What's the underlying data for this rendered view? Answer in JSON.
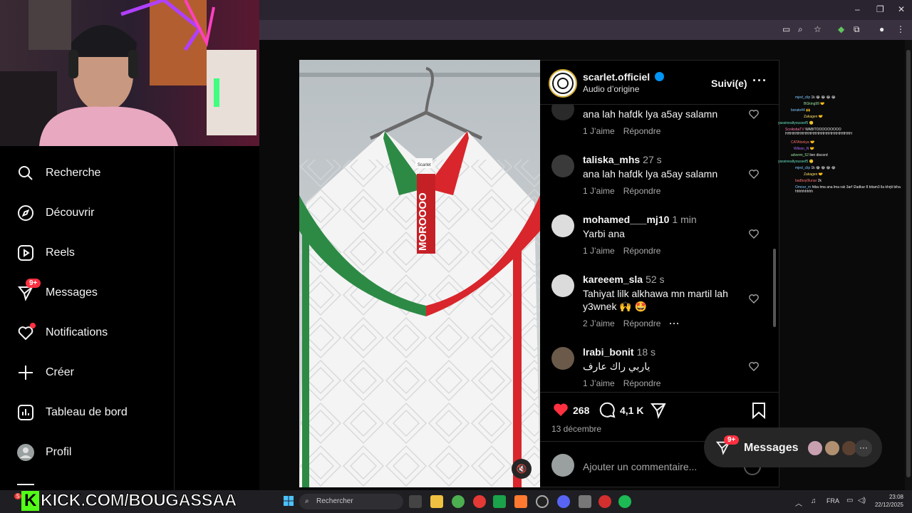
{
  "sidebar": {
    "items": [
      {
        "label": "Recherche",
        "icon": "search-icon"
      },
      {
        "label": "Découvrir",
        "icon": "compass-icon"
      },
      {
        "label": "Reels",
        "icon": "reels-icon"
      },
      {
        "label": "Messages",
        "icon": "messenger-icon",
        "badge": "9+"
      },
      {
        "label": "Notifications",
        "icon": "heart-icon"
      },
      {
        "label": "Créer",
        "icon": "plus-icon"
      },
      {
        "label": "Tableau de bord",
        "icon": "dashboard-icon"
      },
      {
        "label": "Profil",
        "icon": "avatar-icon"
      }
    ]
  },
  "post": {
    "username": "scarlet.officiel",
    "subtitle": "Audio d’origine",
    "follow_label": "Suivi(e)",
    "image_tag": "Scarlet",
    "collar_text": "MOROOOO",
    "likes": "268",
    "comments_count": "4,1 K",
    "date": "13 décembre",
    "add_comment_placeholder": "Ajouter un commentaire..."
  },
  "comments": [
    {
      "user": "",
      "time": "",
      "text": "ana lah hafdk lya a5ay salamn",
      "likes": "1 J’aime",
      "reply": "Répondre"
    },
    {
      "user": "taliska_mhs",
      "time": "27 s",
      "text": "ana lah hafdk lya a5ay salamn",
      "likes": "1 J’aime",
      "reply": "Répondre"
    },
    {
      "user": "mohamed___mj10",
      "time": "1 min",
      "text": "Yarbi ana",
      "likes": "1 J’aime",
      "reply": "Répondre"
    },
    {
      "user": "kareeem_sla",
      "time": "52 s",
      "text": "Tahiyat lilk alkhawa mn martil lah y3wnek 🙌 🤩",
      "likes": "2 J’aime",
      "reply": "Répondre"
    },
    {
      "user": "lrabi_bonit",
      "time": "18 s",
      "text": "ياربي راك عارف",
      "likes": "1 J’aime",
      "reply": "Répondre"
    }
  ],
  "messages_pill": {
    "label": "Messages",
    "badge": "9+"
  },
  "chat": [
    {
      "user": "mjed_clip",
      "msg": "1k 😂 😂 😂 😂",
      "color": "#7ec8ff"
    },
    {
      "user": "BGking99",
      "msg": "🤝",
      "color": "#9ae0a0"
    },
    {
      "user": "borato44",
      "msg": "🙌",
      "color": "#7ec8ff"
    },
    {
      "user": "Zakagen",
      "msg": "🤝",
      "color": "#ffdd66"
    },
    {
      "user": "yassinealtyoussef5",
      "msg": "🙂",
      "color": "#66e0c0"
    },
    {
      "user": "ScoiksbaTV",
      "msg": "WABITOOOOOOOOO HHHHHHHHHHHHHHHHHHHHHHHHHH",
      "color": "#ff7ab0"
    },
    {
      "user": "CATAloniya",
      "msg": "🤝",
      "color": "#ff7070"
    },
    {
      "user": "Wilson_N",
      "msg": "🤝",
      "color": "#b070ff"
    },
    {
      "user": "adverm_52",
      "msg": "lien discord",
      "color": "#9ae0a0"
    },
    {
      "user": "yassinealtyoussef5",
      "msg": "🙂",
      "color": "#66e0c0"
    },
    {
      "user": "mjed_clip",
      "msg": "1k 😂 😂 😂 😂",
      "color": "#7ec8ff"
    },
    {
      "user": "Zakagen",
      "msg": "🤝",
      "color": "#ffdd66"
    },
    {
      "user": "badboy0lunar",
      "msg": "2k",
      "color": "#ff7070"
    },
    {
      "user": "Omour_m",
      "msg": "hiba tma ana lma rak 3arf l2adkar 8 bitam3 lla khrjti biha hhhhhhhhh",
      "color": "#7ec8ff"
    }
  ],
  "taskbar": {
    "kick_text": "KICK.COM/BOUGASSAA",
    "kick_badge": "5",
    "search_placeholder": "Rechercher",
    "lang": "FRA",
    "time": "23:08",
    "date": "22/12/2025"
  },
  "browser": {
    "minimize": "–",
    "maximize": "❐",
    "close": "✕"
  }
}
